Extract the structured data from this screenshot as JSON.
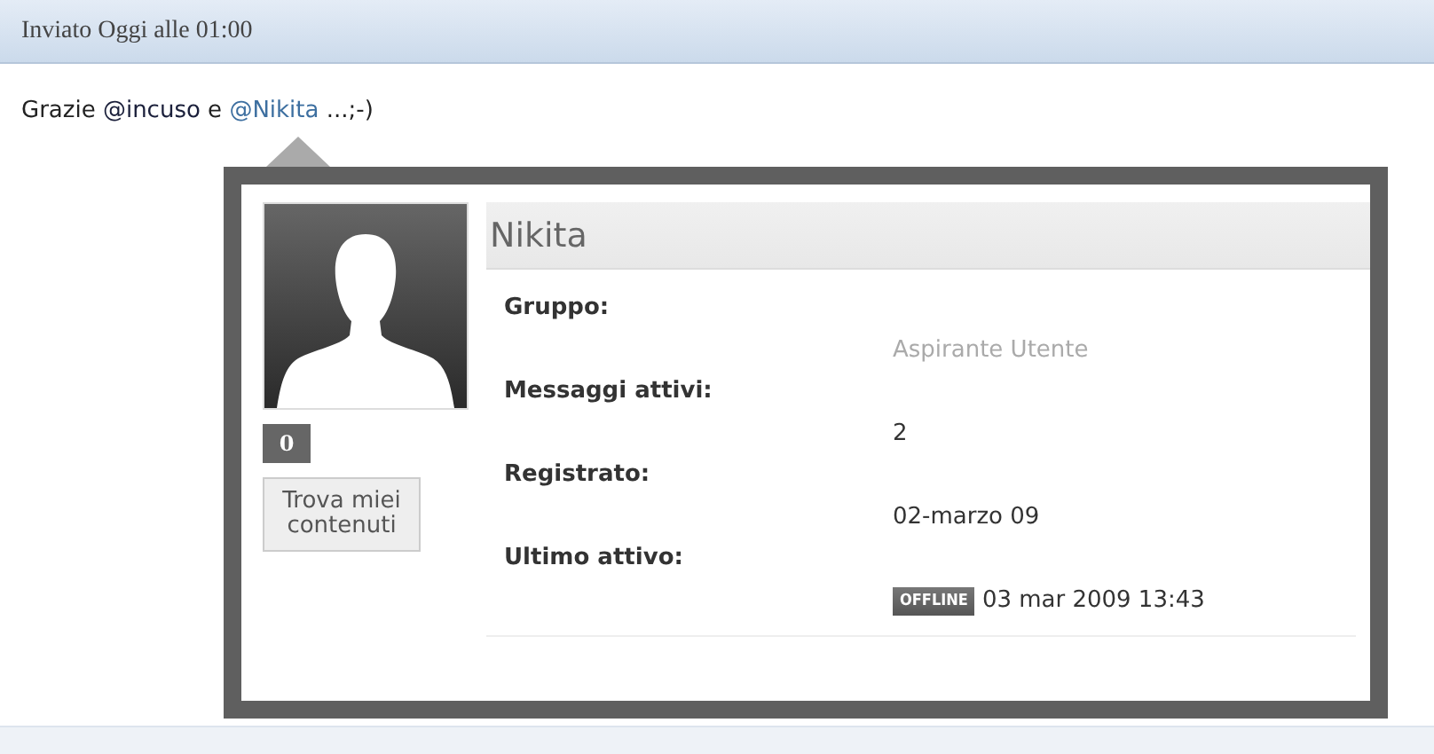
{
  "post_header": {
    "text": "Inviato Oggi alle 01:00"
  },
  "message": [
    {
      "kind": "text",
      "text": "Grazie "
    },
    {
      "kind": "mention",
      "text": "@incuso",
      "active": false
    },
    {
      "kind": "text",
      "text": " e "
    },
    {
      "kind": "mention",
      "text": "@Nikita",
      "active": true
    },
    {
      "kind": "text",
      "text": " ...;-)"
    }
  ],
  "profile_card": {
    "name": "Nikita",
    "reputation": "0",
    "button": "Trova miei contenuti",
    "fields": [
      {
        "kind": "group",
        "label": "Gruppo:",
        "value": "Aspirante Utente"
      },
      {
        "kind": "plain",
        "label": "Messaggi attivi:",
        "value": "2"
      },
      {
        "kind": "plain",
        "label": "Registrato:",
        "value": "02-marzo 09"
      },
      {
        "kind": "status",
        "label": "Ultimo attivo:",
        "status": "OFFLINE",
        "value": "03 mar 2009 13:43"
      }
    ]
  }
}
